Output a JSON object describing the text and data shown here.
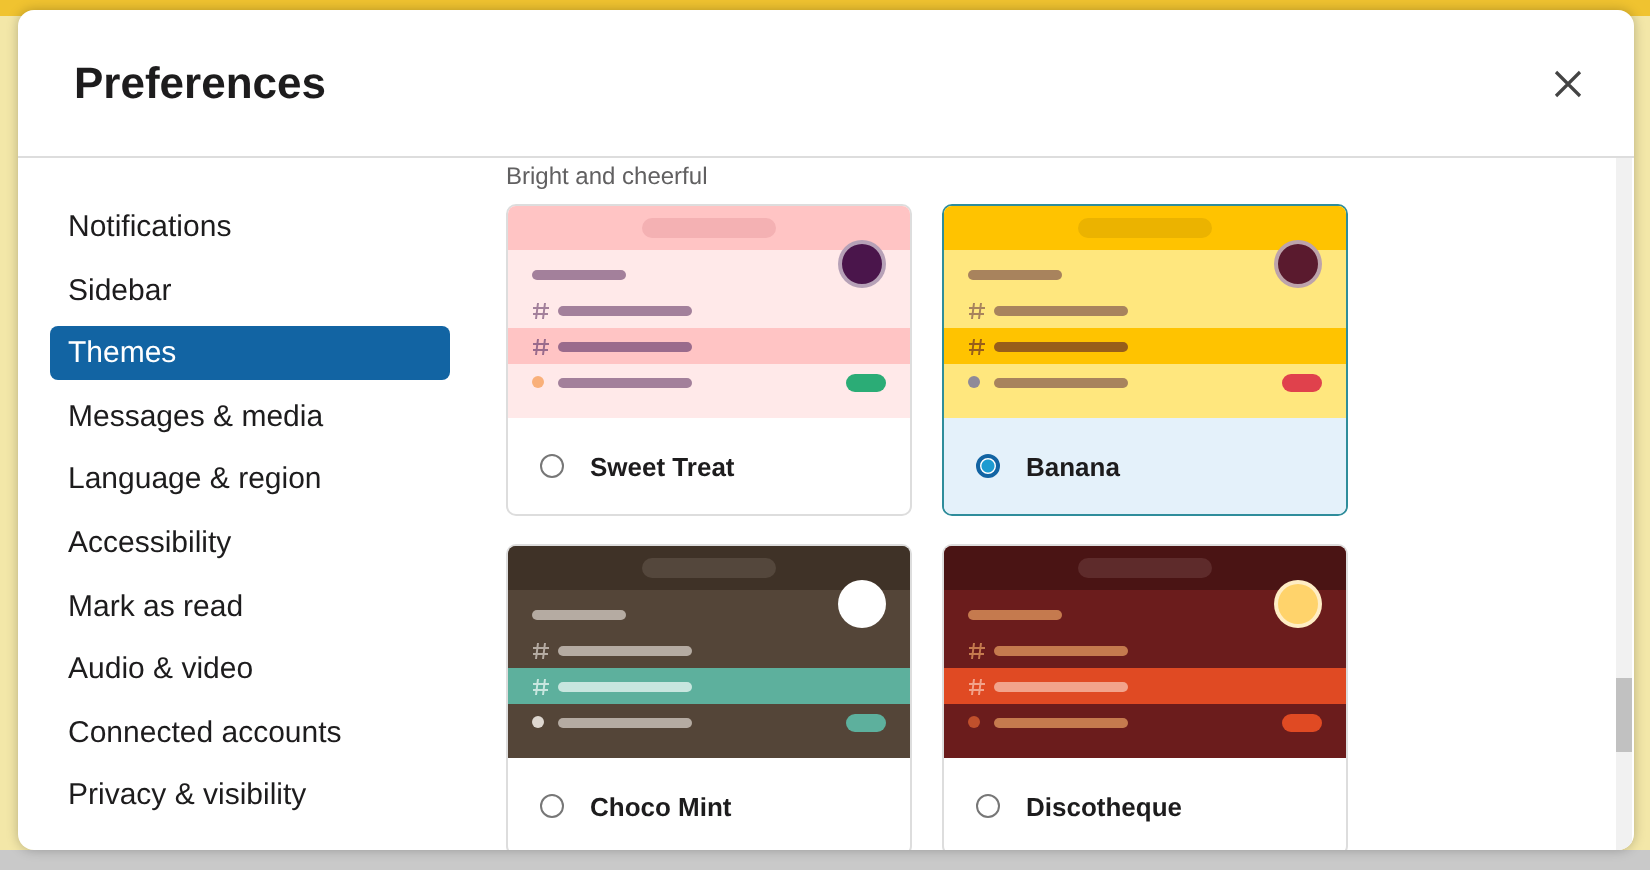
{
  "dialog": {
    "title": "Preferences"
  },
  "nav": [
    {
      "label": "Notifications",
      "selected": false
    },
    {
      "label": "Sidebar",
      "selected": false
    },
    {
      "label": "Themes",
      "selected": true
    },
    {
      "label": "Messages & media",
      "selected": false
    },
    {
      "label": "Language & region",
      "selected": false
    },
    {
      "label": "Accessibility",
      "selected": false
    },
    {
      "label": "Mark as read",
      "selected": false
    },
    {
      "label": "Audio & video",
      "selected": false
    },
    {
      "label": "Connected accounts",
      "selected": false
    },
    {
      "label": "Privacy & visibility",
      "selected": false
    }
  ],
  "section_label": "Bright and cheerful",
  "themes": [
    {
      "name": "Sweet Treat",
      "selected": false,
      "color": "#ffc4c4"
    },
    {
      "name": "Banana",
      "selected": true,
      "color": "#ffc300"
    },
    {
      "name": "Choco Mint",
      "selected": false,
      "color": "#3f3227"
    },
    {
      "name": "Discotheque",
      "selected": false,
      "color": "#4a1414"
    }
  ]
}
